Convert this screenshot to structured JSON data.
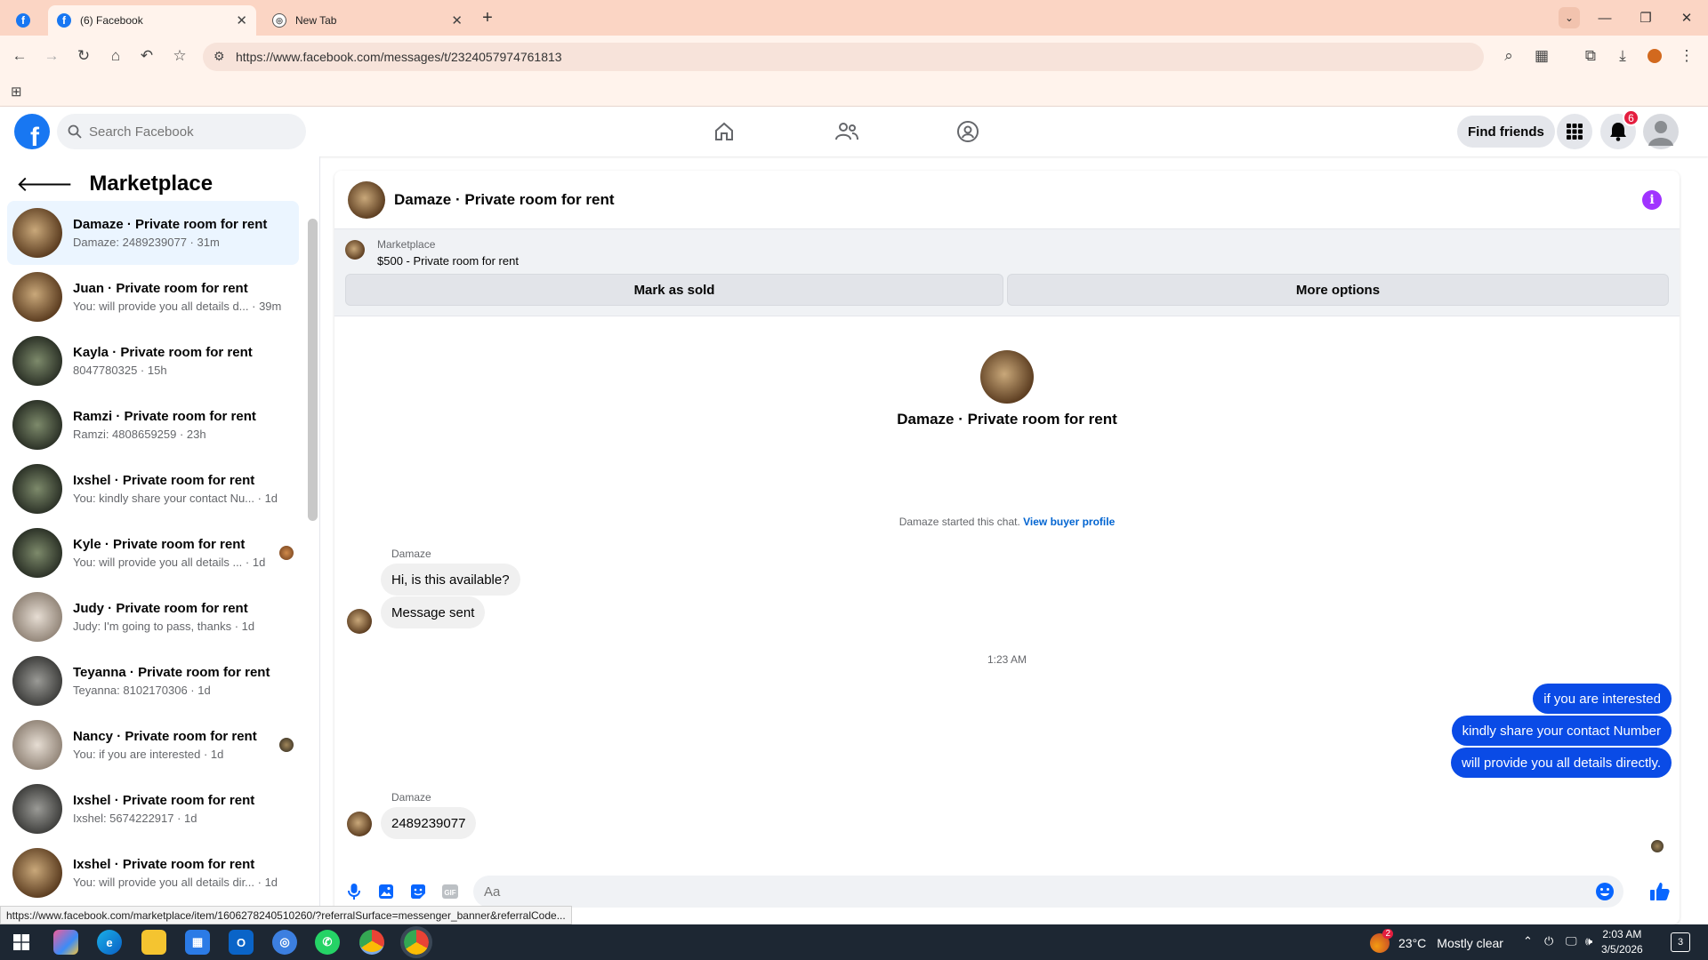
{
  "browser": {
    "tabs": [
      {
        "label": "(6) Facebook"
      },
      {
        "label": "New Tab"
      }
    ],
    "url": "https://www.facebook.com/messages/t/23240579747618​13"
  },
  "facebook": {
    "search_placeholder": "Search Facebook",
    "find_friends_label": "Find friends",
    "notification_count": "6"
  },
  "sidebar": {
    "title": "Marketplace",
    "conversations": [
      {
        "name": "Damaze · Private room for rent",
        "preview": "Damaze: 2489239077 · 31m"
      },
      {
        "name": "Juan · Private room for rent",
        "preview": "You: will provide you all details d... · 39m"
      },
      {
        "name": "Kayla · Private room for rent",
        "preview": "8047780325 · 15h"
      },
      {
        "name": "Ramzi · Private room for rent",
        "preview": "Ramzi: 4808659259 · 23h"
      },
      {
        "name": "Ixshel · Private room for rent",
        "preview": "You: kindly share your contact Nu... · 1d"
      },
      {
        "name": "Kyle · Private room for rent",
        "preview": "You: will provide you all details ... · 1d"
      },
      {
        "name": "Judy · Private room for rent",
        "preview": "Judy: I'm going to pass, thanks · 1d"
      },
      {
        "name": "Teyanna · Private room for rent",
        "preview": "Teyanna: 8102170306 · 1d"
      },
      {
        "name": "Nancy · Private room for rent",
        "preview": "You: if you are interested · 1d"
      },
      {
        "name": "Ixshel · Private room for rent",
        "preview": "Ixshel: 5674222917 · 1d"
      },
      {
        "name": "Ixshel · Private room for rent",
        "preview": "You: will provide you all details dir... · 1d"
      }
    ]
  },
  "chat": {
    "title": "Damaze · Private room for rent",
    "listing_source": "Marketplace",
    "listing_item": "$500 - Private room for rent",
    "mark_sold_label": "Mark as sold",
    "more_options_label": "More options",
    "intro_name": "Damaze · Private room for rent",
    "started_text": "Damaze started this chat.",
    "buyer_profile_link": "View buyer profile",
    "sender1": "Damaze",
    "msg_in_1": "Hi, is this available?",
    "msg_in_2": "Message sent",
    "timestamp": "1:23 AM",
    "msg_out_1": "if you are interested",
    "msg_out_2": "kindly share your contact Number",
    "msg_out_3": "will provide you all details directly.",
    "sender2": "Damaze",
    "msg_in_3": "2489239077",
    "composer_placeholder": "Aa"
  },
  "status_url": "https://www.facebook.com/marketplace/item/1606278240510260/?referralSurface=messenger_banner&referralCode...",
  "taskbar": {
    "weather_temp": "23°C",
    "weather_desc": "Mostly clear",
    "weather_badge": "2",
    "time": "2:03 AM",
    "date": "3/5/2026",
    "notifications": "3"
  }
}
